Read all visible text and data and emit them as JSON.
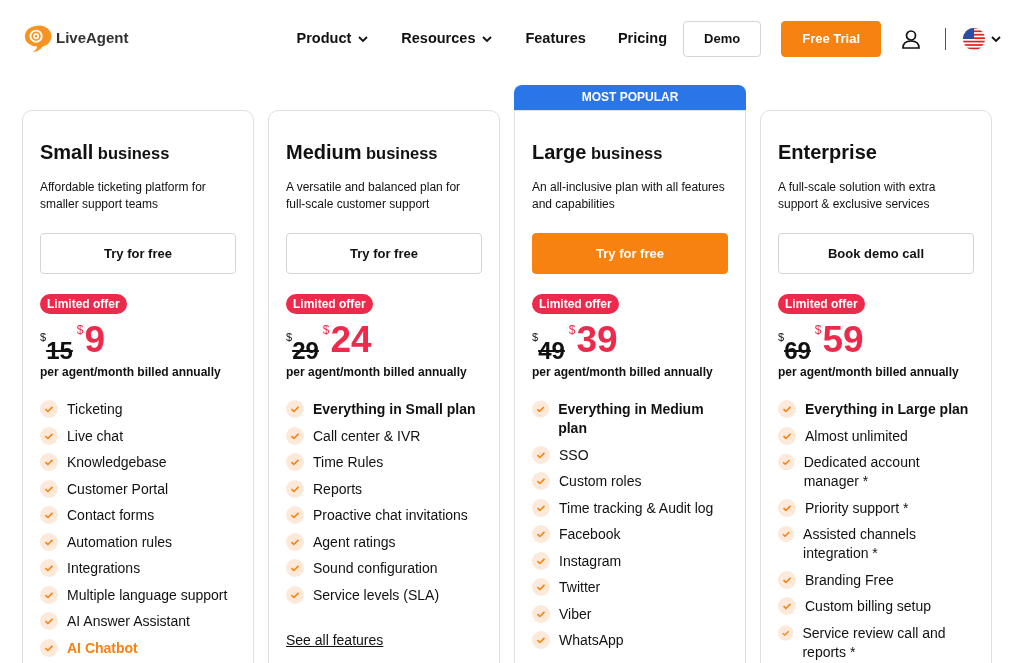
{
  "header": {
    "logo_text": "LiveAgent",
    "nav": [
      {
        "label": "Product",
        "has_dropdown": true
      },
      {
        "label": "Resources",
        "has_dropdown": true
      },
      {
        "label": "Features",
        "has_dropdown": false
      },
      {
        "label": "Pricing",
        "has_dropdown": false
      }
    ],
    "buttons": [
      {
        "label": "Demo",
        "kind": "outline"
      },
      {
        "label": "Free Trial",
        "kind": "primary"
      }
    ]
  },
  "plans": [
    {
      "name": "Small",
      "name_suffix": "business",
      "description": "Affordable ticketing platform for smaller support teams",
      "button": {
        "label": "Try for free",
        "kind": "outline"
      },
      "badge": "Limited offer",
      "old_currency": "$",
      "old_price": "15",
      "new_currency": "$",
      "price": "9",
      "billing": "per agent/month billed annually",
      "features": [
        {
          "text": "Ticketing",
          "kind": "plain"
        },
        {
          "text": "Live chat",
          "kind": "plain"
        },
        {
          "text": "Knowledgebase",
          "kind": "plain"
        },
        {
          "text": "Customer Portal",
          "kind": "plain"
        },
        {
          "text": "Contact forms",
          "kind": "plain"
        },
        {
          "text": "Automation rules",
          "kind": "plain"
        },
        {
          "text": "Integrations",
          "kind": "plain"
        },
        {
          "text": "Multiple language support",
          "kind": "plain"
        },
        {
          "text": "AI Answer Assistant",
          "kind": "plain"
        },
        {
          "text": "AI Chatbot",
          "kind": "highlight"
        }
      ]
    },
    {
      "name": "Medium",
      "name_suffix": "business",
      "description": "A versatile and balanced plan for full-scale customer support",
      "button": {
        "label": "Try for free",
        "kind": "outline"
      },
      "badge": "Limited offer",
      "old_currency": "$",
      "old_price": "29",
      "new_currency": "$",
      "price": "24",
      "billing": "per agent/month billed annually",
      "features": [
        {
          "text": "Everything in Small plan",
          "kind": "bold"
        },
        {
          "text": "Call center & IVR",
          "kind": "plain"
        },
        {
          "text": "Time Rules",
          "kind": "plain"
        },
        {
          "text": "Reports",
          "kind": "plain"
        },
        {
          "text": "Proactive chat invitations",
          "kind": "plain"
        },
        {
          "text": "Agent ratings",
          "kind": "plain"
        },
        {
          "text": "Sound configuration",
          "kind": "plain"
        },
        {
          "text": "Service levels (SLA)",
          "kind": "plain"
        }
      ],
      "link": "See all features"
    },
    {
      "ribbon": "MOST POPULAR",
      "name": "Large",
      "name_suffix": "business",
      "description": "An all-inclusive plan with all features and capabilities",
      "button": {
        "label": "Try for free",
        "kind": "primary"
      },
      "badge": "Limited offer",
      "old_currency": "$",
      "old_price": "49",
      "new_currency": "$",
      "price": "39",
      "billing": "per agent/month billed annually",
      "features": [
        {
          "text": "Everything in Medium plan",
          "kind": "bold"
        },
        {
          "text": "SSO",
          "kind": "plain"
        },
        {
          "text": "Custom roles",
          "kind": "plain"
        },
        {
          "text": "Time tracking & Audit log",
          "kind": "plain"
        },
        {
          "text": "Facebook",
          "kind": "plain"
        },
        {
          "text": "Instagram",
          "kind": "plain"
        },
        {
          "text": "Twitter",
          "kind": "plain"
        },
        {
          "text": "Viber",
          "kind": "plain"
        },
        {
          "text": "WhatsApp",
          "kind": "plain"
        }
      ]
    },
    {
      "name": "Enterprise",
      "description": "A full-scale solution with extra support & exclusive services",
      "button": {
        "label": "Book demo call",
        "kind": "outline"
      },
      "badge": "Limited offer",
      "old_currency": "$",
      "old_price": "69",
      "new_currency": "$",
      "price": "59",
      "billing": "per agent/month billed annually",
      "features": [
        {
          "text": "Everything in Large plan",
          "kind": "bold"
        },
        {
          "text": "Almost unlimited",
          "kind": "plain"
        },
        {
          "text": "Dedicated account manager *",
          "kind": "plain"
        },
        {
          "text": "Priority support *",
          "kind": "plain"
        },
        {
          "text": "Assisted channels integration *",
          "kind": "plain"
        },
        {
          "text": "Branding Free",
          "kind": "plain"
        },
        {
          "text": "Custom billing setup",
          "kind": "plain"
        },
        {
          "text": "Service review call and reports *",
          "kind": "plain"
        }
      ]
    }
  ]
}
